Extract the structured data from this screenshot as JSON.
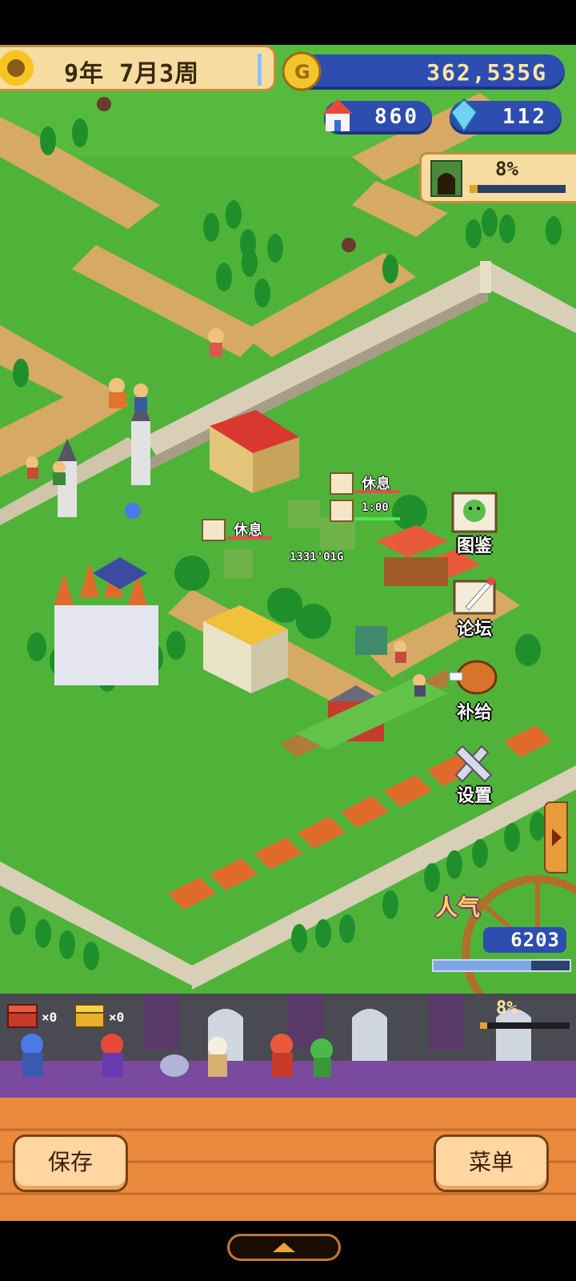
{
  "hud": {
    "date": "9年 7月3周",
    "gold": "362,535G",
    "population": "860",
    "crystals": "112",
    "dungeon_progress": "8%",
    "dungeon_progress_value": 0.08
  },
  "map_labels": {
    "rest_1": "休息",
    "rest_2": "休息",
    "timer": "1:00",
    "shop_price": "1331'01G"
  },
  "side_menu": {
    "encyclopedia": "图鉴",
    "forum": "论坛",
    "supply": "补给",
    "settings": "设置"
  },
  "popularity": {
    "label": "人气",
    "value": "6203",
    "bar_fraction": 0.72
  },
  "party": {
    "red_chest_count": "×0",
    "gold_chest_count": "×0",
    "progress": "8%",
    "progress_value": 0.08
  },
  "bottom": {
    "save_label": "保存",
    "menu_label": "菜单"
  },
  "colors": {
    "grass": "#4fb33a",
    "path": "#d9b06a",
    "wall": "#d8cfb6",
    "hud_blue": "#2d4db0",
    "brick": "#e98a3c"
  }
}
